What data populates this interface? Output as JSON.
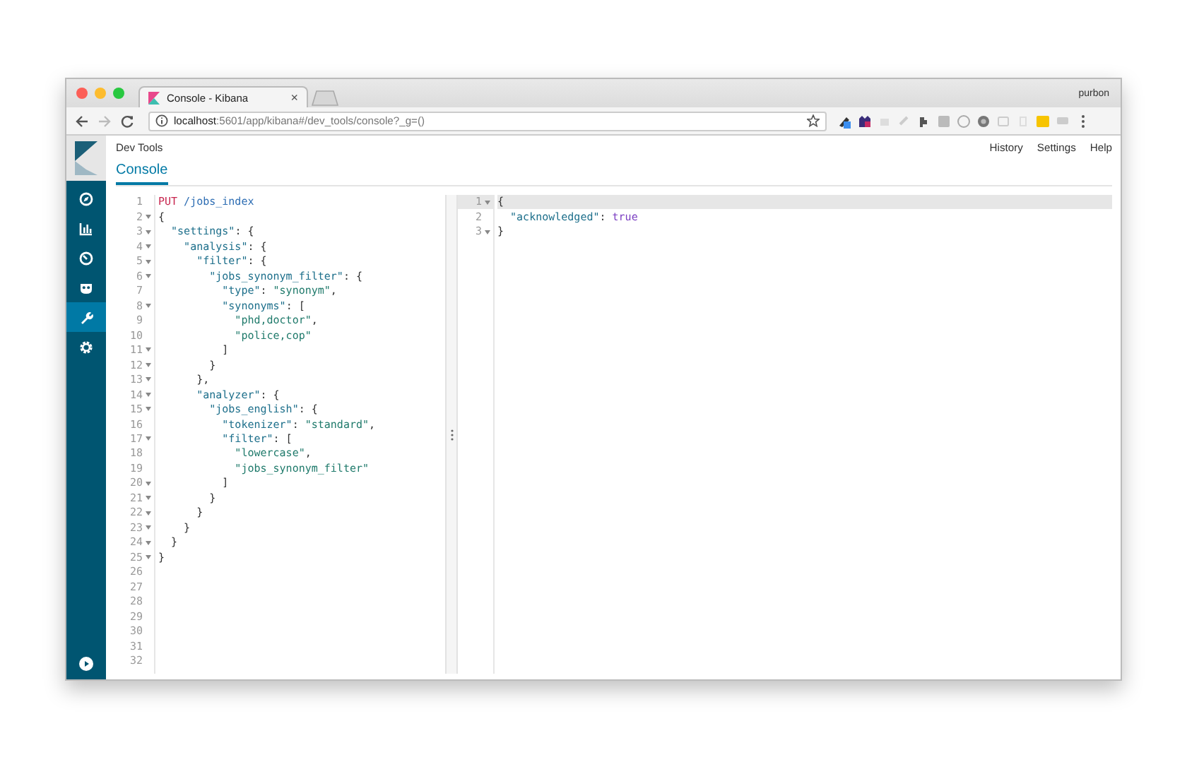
{
  "browser": {
    "tab": {
      "title": "Console - Kibana",
      "close": "×"
    },
    "user": "purbon",
    "address": {
      "host": "localhost",
      "path": ":5601/app/kibana#/dev_tools/console?_g=()"
    }
  },
  "sidebar": {
    "items": [
      {
        "kind": "compass",
        "selected": false
      },
      {
        "kind": "chart",
        "selected": false
      },
      {
        "kind": "gauge",
        "selected": false
      },
      {
        "kind": "mask",
        "selected": false
      },
      {
        "kind": "wrench",
        "selected": true
      },
      {
        "kind": "gear",
        "selected": false
      }
    ]
  },
  "header": {
    "title": "Dev Tools",
    "links": [
      "History",
      "Settings",
      "Help"
    ]
  },
  "tabs": [
    {
      "label": "Console",
      "selected": true
    }
  ],
  "request": {
    "lines": [
      {
        "number": "1",
        "foldable": false,
        "highlighted": false,
        "tokens": [
          {
            "kind": "method",
            "text": "PUT"
          },
          {
            "kind": "path",
            "text": " /jobs_index"
          }
        ]
      },
      {
        "number": "2",
        "foldable": true,
        "highlighted": false,
        "tokens": [
          {
            "kind": "punct",
            "text": "{"
          }
        ]
      },
      {
        "number": "3",
        "foldable": true,
        "highlighted": false,
        "tokens": [
          {
            "kind": "key",
            "text": "  \"settings\""
          },
          {
            "kind": "punct",
            "text": ": {"
          }
        ]
      },
      {
        "number": "4",
        "foldable": true,
        "highlighted": false,
        "tokens": [
          {
            "kind": "key",
            "text": "    \"analysis\""
          },
          {
            "kind": "punct",
            "text": ": {"
          }
        ]
      },
      {
        "number": "5",
        "foldable": true,
        "highlighted": false,
        "tokens": [
          {
            "kind": "key",
            "text": "      \"filter\""
          },
          {
            "kind": "punct",
            "text": ": {"
          }
        ]
      },
      {
        "number": "6",
        "foldable": true,
        "highlighted": false,
        "tokens": [
          {
            "kind": "key",
            "text": "        \"jobs_synonym_filter\""
          },
          {
            "kind": "punct",
            "text": ": {"
          }
        ]
      },
      {
        "number": "7",
        "foldable": false,
        "highlighted": false,
        "tokens": [
          {
            "kind": "key",
            "text": "          \"type\""
          },
          {
            "kind": "punct",
            "text": ": "
          },
          {
            "kind": "string",
            "text": "\"synonym\""
          },
          {
            "kind": "punct",
            "text": ","
          }
        ]
      },
      {
        "number": "8",
        "foldable": true,
        "highlighted": false,
        "tokens": [
          {
            "kind": "key",
            "text": "          \"synonyms\""
          },
          {
            "kind": "punct",
            "text": ": ["
          }
        ]
      },
      {
        "number": "9",
        "foldable": false,
        "highlighted": false,
        "tokens": [
          {
            "kind": "string",
            "text": "            \"phd,doctor\""
          },
          {
            "kind": "punct",
            "text": ","
          }
        ]
      },
      {
        "number": "10",
        "foldable": false,
        "highlighted": false,
        "tokens": [
          {
            "kind": "string",
            "text": "            \"police,cop\""
          }
        ]
      },
      {
        "number": "11",
        "foldable": true,
        "highlighted": false,
        "tokens": [
          {
            "kind": "punct",
            "text": "          ]"
          }
        ]
      },
      {
        "number": "12",
        "foldable": true,
        "highlighted": false,
        "tokens": [
          {
            "kind": "punct",
            "text": "        }"
          }
        ]
      },
      {
        "number": "13",
        "foldable": true,
        "highlighted": false,
        "tokens": [
          {
            "kind": "punct",
            "text": "      },"
          }
        ]
      },
      {
        "number": "14",
        "foldable": true,
        "highlighted": false,
        "tokens": [
          {
            "kind": "key",
            "text": "      \"analyzer\""
          },
          {
            "kind": "punct",
            "text": ": {"
          }
        ]
      },
      {
        "number": "15",
        "foldable": true,
        "highlighted": false,
        "tokens": [
          {
            "kind": "key",
            "text": "        \"jobs_english\""
          },
          {
            "kind": "punct",
            "text": ": {"
          }
        ]
      },
      {
        "number": "16",
        "foldable": false,
        "highlighted": false,
        "tokens": [
          {
            "kind": "key",
            "text": "          \"tokenizer\""
          },
          {
            "kind": "punct",
            "text": ": "
          },
          {
            "kind": "string",
            "text": "\"standard\""
          },
          {
            "kind": "punct",
            "text": ","
          }
        ]
      },
      {
        "number": "17",
        "foldable": true,
        "highlighted": false,
        "tokens": [
          {
            "kind": "key",
            "text": "          \"filter\""
          },
          {
            "kind": "punct",
            "text": ": ["
          }
        ]
      },
      {
        "number": "18",
        "foldable": false,
        "highlighted": false,
        "tokens": [
          {
            "kind": "string",
            "text": "            \"lowercase\""
          },
          {
            "kind": "punct",
            "text": ","
          }
        ]
      },
      {
        "number": "19",
        "foldable": false,
        "highlighted": false,
        "tokens": [
          {
            "kind": "string",
            "text": "            \"jobs_synonym_filter\""
          }
        ]
      },
      {
        "number": "20",
        "foldable": true,
        "highlighted": false,
        "tokens": [
          {
            "kind": "punct",
            "text": "          ]"
          }
        ]
      },
      {
        "number": "21",
        "foldable": true,
        "highlighted": false,
        "tokens": [
          {
            "kind": "punct",
            "text": "        }"
          }
        ]
      },
      {
        "number": "22",
        "foldable": true,
        "highlighted": false,
        "tokens": [
          {
            "kind": "punct",
            "text": "      }"
          }
        ]
      },
      {
        "number": "23",
        "foldable": true,
        "highlighted": false,
        "tokens": [
          {
            "kind": "punct",
            "text": "    }"
          }
        ]
      },
      {
        "number": "24",
        "foldable": true,
        "highlighted": false,
        "tokens": [
          {
            "kind": "punct",
            "text": "  }"
          }
        ]
      },
      {
        "number": "25",
        "foldable": true,
        "highlighted": false,
        "tokens": [
          {
            "kind": "punct",
            "text": "}"
          }
        ]
      },
      {
        "number": "26",
        "foldable": false,
        "highlighted": false
      },
      {
        "number": "27",
        "foldable": false,
        "highlighted": false
      },
      {
        "number": "28",
        "foldable": false,
        "highlighted": false
      },
      {
        "number": "29",
        "foldable": false,
        "highlighted": false
      },
      {
        "number": "30",
        "foldable": false,
        "highlighted": false
      },
      {
        "number": "31",
        "foldable": false,
        "highlighted": false
      },
      {
        "number": "32",
        "foldable": false,
        "highlighted": false
      }
    ]
  },
  "response": {
    "lines": [
      {
        "number": "1",
        "foldable": true,
        "highlighted": true,
        "tokens": [
          {
            "kind": "punct",
            "text": "{"
          }
        ]
      },
      {
        "number": "2",
        "foldable": false,
        "highlighted": false,
        "tokens": [
          {
            "kind": "key",
            "text": "  \"acknowledged\""
          },
          {
            "kind": "punct",
            "text": ": "
          },
          {
            "kind": "boolean",
            "text": "true"
          }
        ]
      },
      {
        "number": "3",
        "foldable": true,
        "highlighted": false,
        "tokens": [
          {
            "kind": "punct",
            "text": "}"
          }
        ]
      }
    ]
  }
}
